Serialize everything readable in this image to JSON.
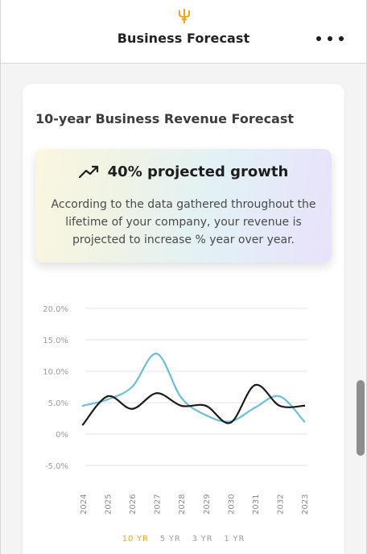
{
  "header": {
    "title": "Business Forecast",
    "logo_icon": "trident-icon",
    "more_icon": "more-horizontal-icon"
  },
  "card": {
    "title": "10-year Business Revenue Forecast",
    "growth": {
      "icon": "trending-up-icon",
      "headline": "40% projected growth",
      "description": "According to the data gathered throughout the lifetime of your company, your revenue is projected to increase % year over year."
    },
    "range_tabs": [
      "10 YR",
      "5 YR",
      "3 YR",
      "1 YR"
    ],
    "active_range": "10 YR"
  },
  "colors": {
    "accent": "#f0a41c",
    "series_blue": "#6cbfd3",
    "series_black": "#1b1b1b"
  },
  "chart_data": {
    "type": "line",
    "x": [
      "2024",
      "2025",
      "2026",
      "2027",
      "2028",
      "2029",
      "2030",
      "2031",
      "2032",
      "2023"
    ],
    "y_ticks": [
      "20.0%",
      "15.0%",
      "10.0%",
      "5.0%",
      "0%",
      "-5.0%"
    ],
    "ylim": [
      -5,
      20
    ],
    "grid": true,
    "series": [
      {
        "values": [
          4.5,
          5.5,
          7.5,
          12.8,
          5.8,
          3.0,
          2.0,
          4.2,
          6.0,
          2.0
        ]
      },
      {
        "values": [
          1.5,
          6.0,
          4.0,
          6.5,
          4.5,
          4.5,
          1.8,
          7.8,
          4.5,
          4.5
        ]
      }
    ]
  }
}
